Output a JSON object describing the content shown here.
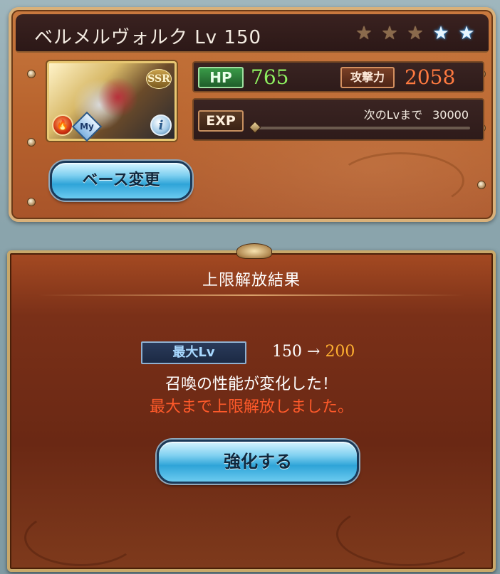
{
  "summon": {
    "title": "ベルメルヴォルク Lv 150",
    "rarity_badge": "SSR",
    "my_badge": "My",
    "info_icon_label": "i",
    "stars": [
      "bronze",
      "bronze",
      "bronze",
      "blue",
      "blue"
    ]
  },
  "stats": {
    "hp_label": "HP",
    "hp_value": "765",
    "attack_label": "攻撃力",
    "attack_value": "2058",
    "exp_label": "EXP",
    "next_lv_label": "次のLvまで",
    "next_lv_value": "30000",
    "exp_progress": 0
  },
  "buttons": {
    "change_base": "ベース変更",
    "enhance": "強化する"
  },
  "result": {
    "title": "上限解放結果",
    "max_lv_label": "最大Lv",
    "lv_from": "150",
    "arrow": "→",
    "lv_to": "200",
    "message": "召喚の性能が変化した！",
    "max_message": "最大まで上限解放しました。"
  },
  "colors": {
    "hp_value": "#8ef060",
    "attack_value": "#ff7a40",
    "lv_to": "#ffb030",
    "max_message": "#ff5a2a",
    "button_blue": "#2fa4d8"
  }
}
